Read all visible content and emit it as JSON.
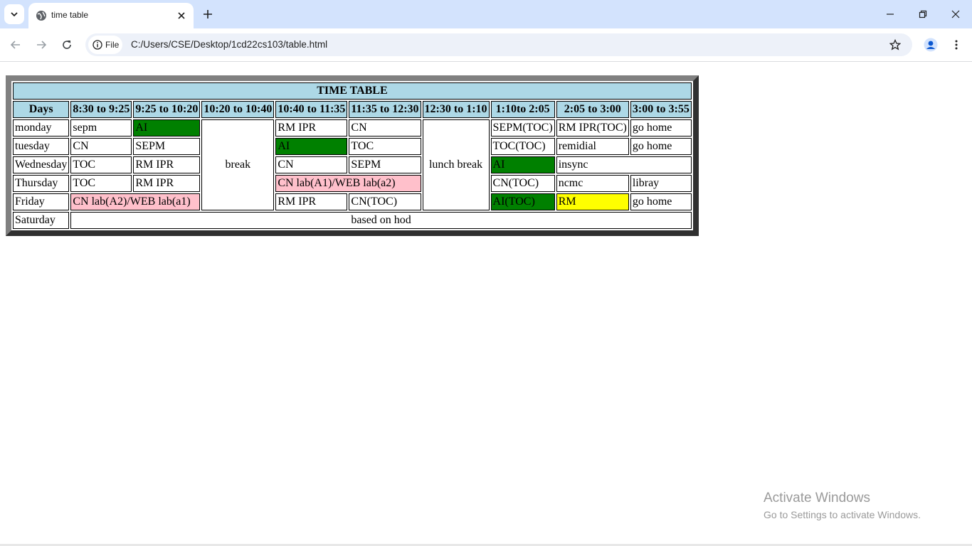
{
  "browser": {
    "tab_title": "time table",
    "site_chip_label": "File",
    "url": "C:/Users/CSE/Desktop/1cd22cs103/table.html"
  },
  "timetable": {
    "title": "TIME TABLE",
    "headers": [
      "Days",
      "8:30 to 9:25",
      "9:25 to 10:20",
      "10:20 to 10:40",
      "10:40 to 11:35",
      "11:35 to 12:30",
      "12:30 to 1:10",
      "1:10to 2:05",
      "2:05 to 3:00",
      "3:00 to 3:55"
    ],
    "break_label": "break",
    "lunch_label": "lunch break",
    "rows": {
      "monday": {
        "day": "monday",
        "c1": "sepm",
        "c2": "AI",
        "c4": "RM IPR",
        "c5": "CN",
        "c7": "SEPM(TOC)",
        "c8": "RM IPR(TOC)",
        "c9": "go home"
      },
      "tuesday": {
        "day": "tuesday",
        "c1": "CN",
        "c2": "SEPM",
        "c4": "AI",
        "c5": "TOC",
        "c7": "TOC(TOC)",
        "c8": "remidial",
        "c9": "go home"
      },
      "wednesday": {
        "day": "Wednesday",
        "c1": "TOC",
        "c2": "RM IPR",
        "c4": "CN",
        "c5": "SEPM",
        "c7": "AI",
        "c8": "insync"
      },
      "thursday": {
        "day": "Thursday",
        "c1": "TOC",
        "c2": "RM IPR",
        "c4": "CN lab(A1)/WEB lab(a2)",
        "c7": "CN(TOC)",
        "c8": "ncmc",
        "c9": "libray"
      },
      "friday": {
        "day": "Friday",
        "c1": "CN lab(A2)/WEB lab(a1)",
        "c4": "RM IPR",
        "c5": "CN(TOC)",
        "c7": "AI(TOC)",
        "c8": "RM",
        "c9": "go home"
      },
      "saturday": {
        "day": "Saturday",
        "c1": "based on hod"
      }
    }
  },
  "watermark": {
    "line1": "Activate Windows",
    "line2": "Go to Settings to activate Windows."
  },
  "colors": {
    "header_bg": "#add8e6",
    "green": "#008000",
    "pink": "#ffc0cb",
    "yellow": "#ffff00"
  }
}
